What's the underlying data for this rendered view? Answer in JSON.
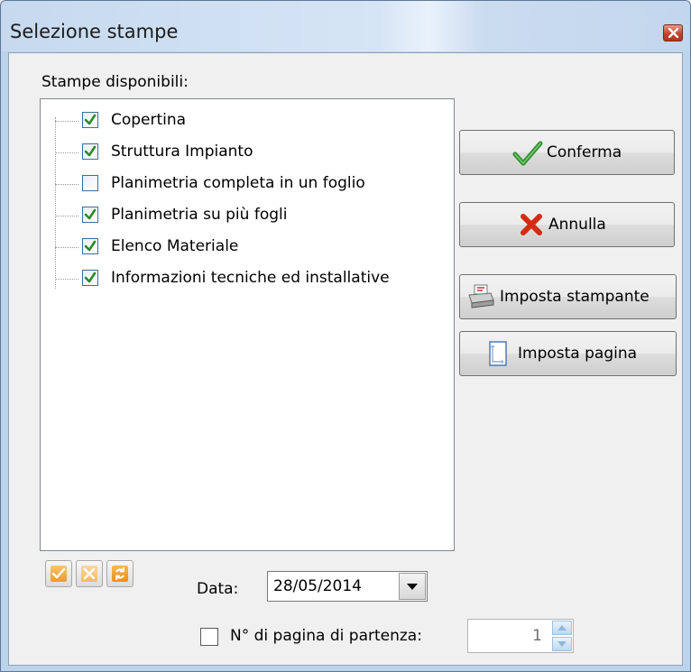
{
  "window": {
    "title": "Selezione stampe",
    "close_icon": "close-icon"
  },
  "list": {
    "label": "Stampe disponibili:",
    "items": [
      {
        "label": "Copertina",
        "checked": true
      },
      {
        "label": "Struttura Impianto",
        "checked": true
      },
      {
        "label": "Planimetria completa in un foglio",
        "checked": false
      },
      {
        "label": "Planimetria su più fogli",
        "checked": true
      },
      {
        "label": "Elenco Materiale",
        "checked": true
      },
      {
        "label": "Informazioni tecniche ed installative",
        "checked": true
      }
    ]
  },
  "buttons": {
    "confirm": {
      "label": "Conferma",
      "icon": "checkmark-icon"
    },
    "cancel": {
      "label": "Annulla",
      "icon": "x-icon"
    },
    "printer_setup": {
      "label": "Imposta stampante",
      "icon": "printer-icon"
    },
    "page_setup": {
      "label": "Imposta pagina",
      "icon": "page-icon"
    }
  },
  "toolbar": {
    "select_all_icon": "check-all-icon",
    "deselect_all_icon": "uncheck-all-icon",
    "invert_icon": "invert-selection-icon"
  },
  "date": {
    "label": "Data:",
    "value": "28/05/2014"
  },
  "start_page": {
    "label": "N° di pagina di partenza:",
    "checked": false,
    "value": "1"
  },
  "colors": {
    "accent_check": "#2b8a2b",
    "cancel_red": "#d42b12",
    "toolbar_orange": "#f4a83a"
  }
}
